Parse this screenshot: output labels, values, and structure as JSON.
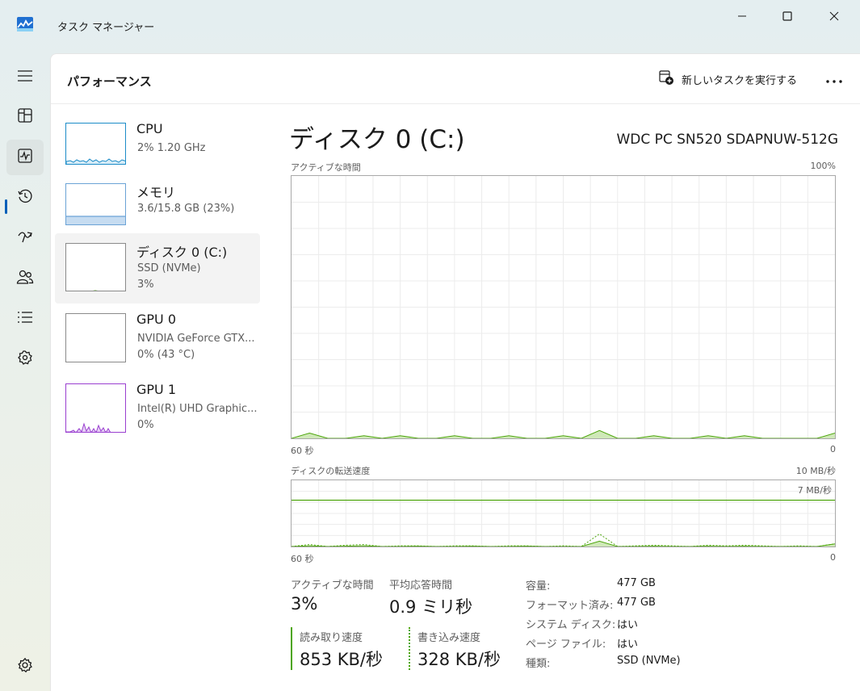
{
  "window": {
    "title": "タスク マネージャー"
  },
  "header": {
    "page_title": "パフォーマンス",
    "run_task_label": "新しいタスクを実行する"
  },
  "nav": {
    "items": [
      {
        "name": "menu-icon"
      },
      {
        "name": "processes-icon"
      },
      {
        "name": "performance-icon"
      },
      {
        "name": "app-history-icon"
      },
      {
        "name": "startup-apps-icon"
      },
      {
        "name": "users-icon"
      },
      {
        "name": "details-icon"
      },
      {
        "name": "services-icon"
      },
      {
        "name": "settings-icon"
      }
    ]
  },
  "devices": [
    {
      "name": "CPU",
      "sub1": "2%  1.20 GHz",
      "sub2": ""
    },
    {
      "name": "メモリ",
      "sub1": "3.6/15.8 GB (23%)",
      "sub2": ""
    },
    {
      "name": "ディスク 0 (C:)",
      "sub1": "SSD (NVMe)",
      "sub2": "3%"
    },
    {
      "name": "GPU 0",
      "sub1": "NVIDIA GeForce GTX...",
      "sub2": "0% (43 °C)"
    },
    {
      "name": "GPU 1",
      "sub1": "Intel(R) UHD Graphic...",
      "sub2": "0%"
    }
  ],
  "detail": {
    "title": "ディスク 0 (C:)",
    "model": "WDC PC SN520 SDAPNUW-512G",
    "active_time_label": "アクティブな時間",
    "active_time_max": "100%",
    "time_left": "60 秒",
    "time_right": "0",
    "transfer_label": "ディスクの転送速度",
    "transfer_max": "10 MB/秒",
    "transfer_line_label": "7 MB/秒",
    "transfer_time_left": "60 秒",
    "transfer_time_right": "0"
  },
  "stats": {
    "active_time": {
      "label": "アクティブな時間",
      "value": "3%"
    },
    "avg_response": {
      "label": "平均応答時間",
      "value": "0.9 ミリ秒"
    },
    "read": {
      "label": "読み取り速度",
      "value": "853 KB/秒"
    },
    "write": {
      "label": "書き込み速度",
      "value": "328 KB/秒"
    }
  },
  "info": [
    {
      "k": "容量:",
      "v": "477 GB"
    },
    {
      "k": "フォーマット済み:",
      "v": "477 GB"
    },
    {
      "k": "システム ディスク:",
      "v": "はい"
    },
    {
      "k": "ページ ファイル:",
      "v": "はい"
    },
    {
      "k": "種類:",
      "v": "SSD (NVMe)"
    }
  ],
  "colors": {
    "accent": "#005fb8",
    "disk_green": "#4da60c",
    "cpu_blue": "#1c8cc8",
    "memory_blue": "#6ba3d6",
    "gpu_purple": "#9a3fd0"
  },
  "chart_data": [
    {
      "type": "area",
      "title": "アクティブな時間",
      "ylim": [
        0,
        100
      ],
      "x": [
        60,
        58,
        56,
        54,
        52,
        50,
        48,
        46,
        44,
        42,
        40,
        38,
        36,
        34,
        32,
        30,
        28,
        26,
        24,
        22,
        20,
        18,
        16,
        14,
        12,
        10,
        8,
        6,
        4,
        2,
        0
      ],
      "series": [
        {
          "values": [
            0,
            2,
            0,
            0,
            1,
            0,
            1,
            0,
            0,
            1,
            0,
            0,
            1,
            0,
            0,
            1,
            0,
            3,
            0,
            0,
            1,
            0,
            0,
            1,
            0,
            1,
            0,
            0,
            0,
            0,
            2
          ]
        }
      ]
    },
    {
      "type": "line",
      "title": "ディスクの転送速度",
      "ylim": [
        0,
        10
      ],
      "x": [
        60,
        58,
        56,
        54,
        52,
        50,
        48,
        46,
        44,
        42,
        40,
        38,
        36,
        34,
        32,
        30,
        28,
        26,
        24,
        22,
        20,
        18,
        16,
        14,
        12,
        10,
        8,
        6,
        4,
        2,
        0
      ],
      "series": [
        {
          "values": [
            0,
            0.1,
            0,
            0.05,
            0.1,
            0,
            0,
            0.05,
            0,
            0,
            0.05,
            0,
            0,
            0.05,
            0,
            0,
            0,
            0.8,
            0,
            0,
            0.05,
            0,
            0,
            0.05,
            0,
            0.05,
            0,
            0,
            0,
            0,
            0.4
          ]
        },
        {
          "values": [
            0,
            0.3,
            0,
            0.2,
            0.3,
            0,
            0.1,
            0.1,
            0,
            0.1,
            0.1,
            0,
            0.1,
            0.1,
            0,
            0.1,
            0,
            1.9,
            0,
            0.1,
            0.2,
            0.1,
            0,
            0.2,
            0.1,
            0.2,
            0.1,
            0,
            0.1,
            0,
            0.4
          ]
        }
      ],
      "reference_line": 7
    }
  ]
}
